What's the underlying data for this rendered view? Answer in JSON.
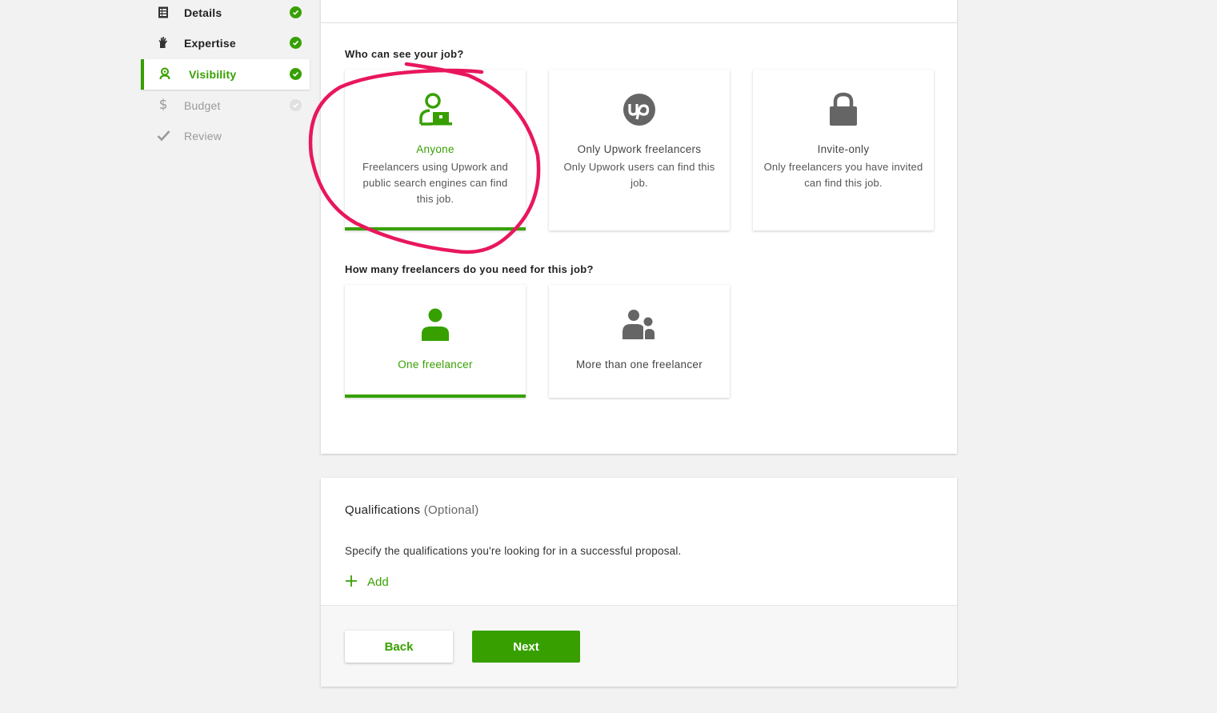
{
  "sidebar": {
    "items": [
      {
        "label": "Details",
        "icon": "list-icon",
        "state": "done"
      },
      {
        "label": "Expertise",
        "icon": "hand-icon",
        "state": "done"
      },
      {
        "label": "Visibility",
        "icon": "person-search-icon",
        "state": "active"
      },
      {
        "label": "Budget",
        "icon": "dollar-icon",
        "state": "pending"
      },
      {
        "label": "Review",
        "icon": "checkmark-icon",
        "state": "pending"
      }
    ]
  },
  "visibility": {
    "question": "Who can see your job?",
    "options": [
      {
        "title": "Anyone",
        "description": "Freelancers using Upwork and public search engines can find this job.",
        "icon": "person-laptop-icon",
        "selected": true
      },
      {
        "title": "Only Upwork freelancers",
        "description": "Only Upwork users can find this job.",
        "icon": "upwork-logo-icon",
        "selected": false
      },
      {
        "title": "Invite-only",
        "description": "Only freelancers you have invited can find this job.",
        "icon": "lock-icon",
        "selected": false
      }
    ]
  },
  "freelancers": {
    "question": "How many freelancers do you need for this job?",
    "options": [
      {
        "title": "One freelancer",
        "icon": "single-person-icon",
        "selected": true
      },
      {
        "title": "More than one freelancer",
        "icon": "group-icon",
        "selected": false
      }
    ]
  },
  "qualifications": {
    "title": "Qualifications",
    "optional": "(Optional)",
    "description": "Specify the qualifications you're looking for in a successful proposal.",
    "add_label": "Add",
    "add_icon": "plus-icon"
  },
  "footer": {
    "back_label": "Back",
    "next_label": "Next"
  },
  "colors": {
    "accent": "#37a000",
    "annotation": "#e8175d",
    "icon_gray": "#656565"
  }
}
